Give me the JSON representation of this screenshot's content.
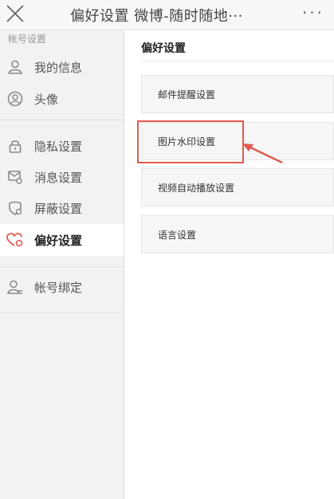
{
  "topbar": {
    "title": "偏好设置 微博-随时随地···",
    "close_icon": "close-icon",
    "more_label": "···"
  },
  "sidebar": {
    "section_label": "帐号设置",
    "items": [
      {
        "label": "我的信息",
        "icon": "person-icon"
      },
      {
        "label": "头像",
        "icon": "avatar-icon"
      },
      {
        "label": "隐私设置",
        "icon": "lock-icon"
      },
      {
        "label": "消息设置",
        "icon": "message-gear-icon"
      },
      {
        "label": "屏蔽设置",
        "icon": "shield-block-icon"
      },
      {
        "label": "偏好设置",
        "icon": "heart-gear-icon",
        "active": true
      },
      {
        "label": "帐号绑定",
        "icon": "account-bind-icon"
      }
    ]
  },
  "main": {
    "title": "偏好设置",
    "items": [
      {
        "label": "邮件提醒设置"
      },
      {
        "label": "图片水印设置",
        "highlighted": true
      },
      {
        "label": "视频自动播放设置"
      },
      {
        "label": "语言设置"
      }
    ]
  },
  "colors": {
    "accent_red": "#e05a4f",
    "icon_gray": "#8a8a8a",
    "sidebar_bg": "#f2f2f2"
  }
}
